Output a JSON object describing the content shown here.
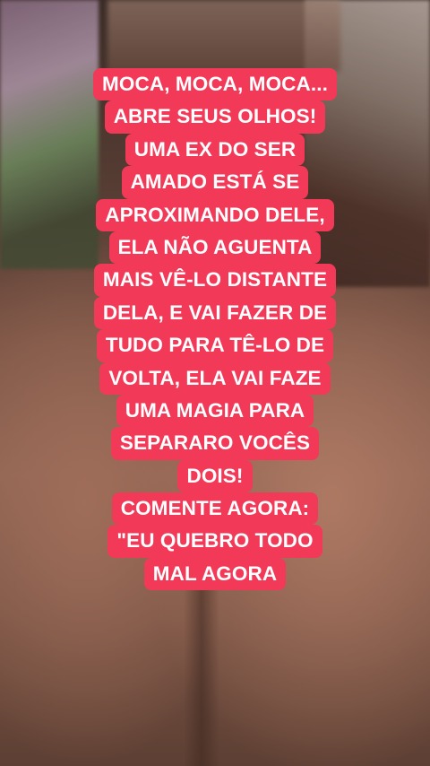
{
  "caption": {
    "background_color": "#f23a58",
    "text_color": "#ffffff",
    "lines": [
      "MOCA, MOCA, MOCA...",
      "ABRE SEUS OLHOS!",
      "UMA EX DO SER",
      "AMADO ESTÁ SE",
      "APROXIMANDO DELE,",
      "ELA NÃO AGUENTA",
      "MAIS VÊ-LO DISTANTE",
      "DELA, E VAI FAZER DE",
      "TUDO PARA TÊ-LO DE",
      "VOLTA, ELA VAI FAZE",
      "UMA MAGIA PARA",
      "SEPARARO VOCÊS",
      "DOIS!",
      "COMENTE AGORA:",
      "\"EU QUEBRO TODO",
      "MAL AGORA"
    ]
  }
}
